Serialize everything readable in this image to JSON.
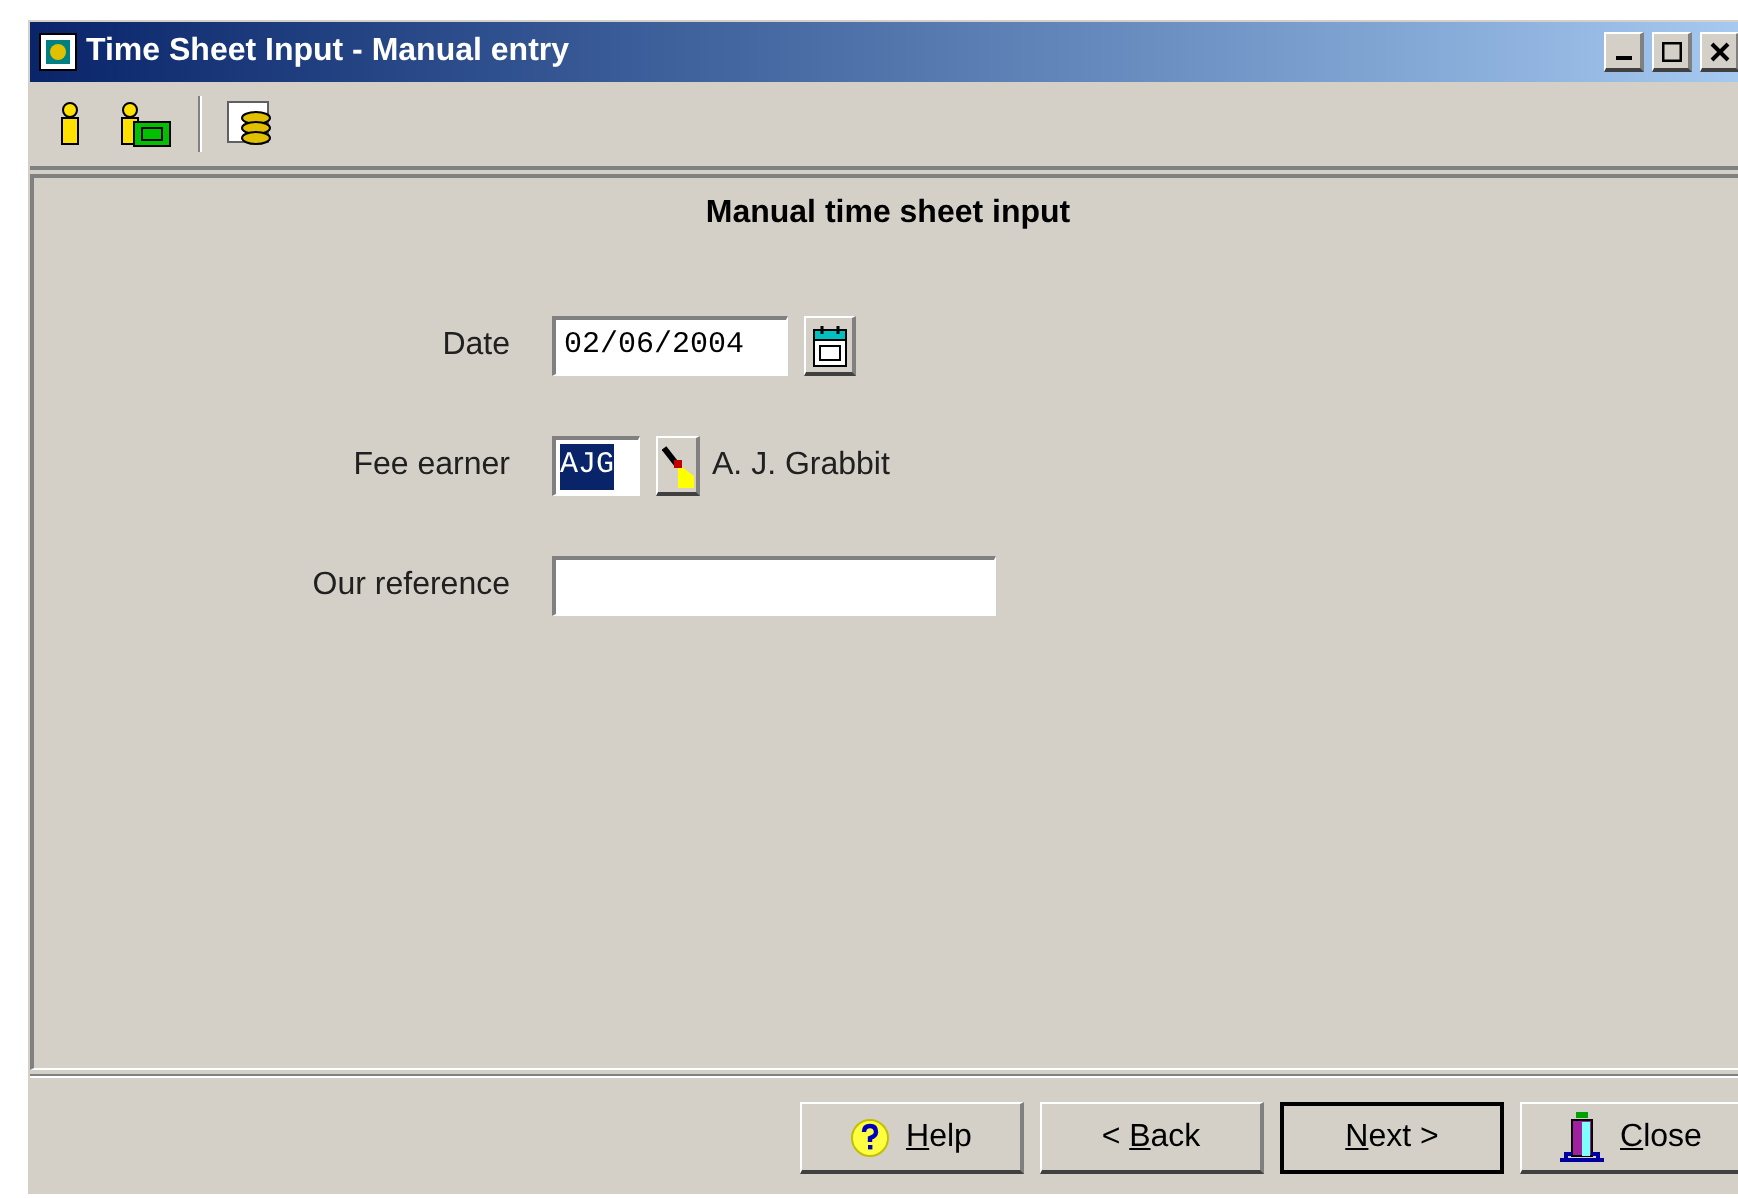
{
  "window": {
    "title": "Time Sheet Input - Manual entry"
  },
  "heading": "Manual time sheet input",
  "fields": [
    {
      "kind": "date",
      "label": "Date",
      "value": "02/06/2004"
    },
    {
      "kind": "lookup",
      "label": "Fee earner",
      "value": "AJG",
      "value_selected": true,
      "name": "A. J. Grabbit"
    },
    {
      "kind": "text",
      "label": "Our reference"
    }
  ],
  "buttons": [
    {
      "kind": "help",
      "key": "H",
      "after": "elp",
      "default": false
    },
    {
      "kind": "back",
      "before": "< ",
      "key": "B",
      "after": "ack",
      "default": false
    },
    {
      "kind": "next",
      "key": "N",
      "after": "ext >",
      "default": true
    },
    {
      "kind": "close",
      "key": "C",
      "after": "lose",
      "default": false
    }
  ]
}
